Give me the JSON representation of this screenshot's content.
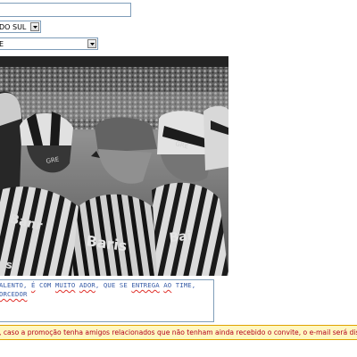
{
  "form": {
    "name_input": {
      "value": ""
    },
    "state_select": {
      "selected": "DO SUL"
    },
    "city_select": {
      "selected": "E"
    }
  },
  "photo": {
    "alt": "Crowd of fans in striped jerseys"
  },
  "message": {
    "lines": [
      [
        {
          "t": "ALENTO, "
        },
        {
          "t": "É",
          "spell": true
        },
        {
          "t": " COM "
        },
        {
          "t": "MUITO",
          "spell": true
        },
        {
          "t": " "
        },
        {
          "t": "ADOR",
          "spell": true
        },
        {
          "t": ", QUE SE "
        },
        {
          "t": "ENTREGA",
          "spell": true
        },
        {
          "t": " "
        },
        {
          "t": "AO",
          "spell": true
        },
        {
          "t": " TIME,"
        }
      ],
      [
        {
          "t": "ORCEDOR",
          "spell": true
        }
      ]
    ]
  },
  "notice": {
    "text": ", caso a promoção tenha amigos relacionados que não tenham ainda recebido o convite, o e-mail será dispa"
  },
  "colors": {
    "field_border": "#7f9db9",
    "message_text": "#3a5ea8",
    "notice_bg": "#fff7c0",
    "notice_border": "#e0a200",
    "notice_text": "#b3001b"
  }
}
